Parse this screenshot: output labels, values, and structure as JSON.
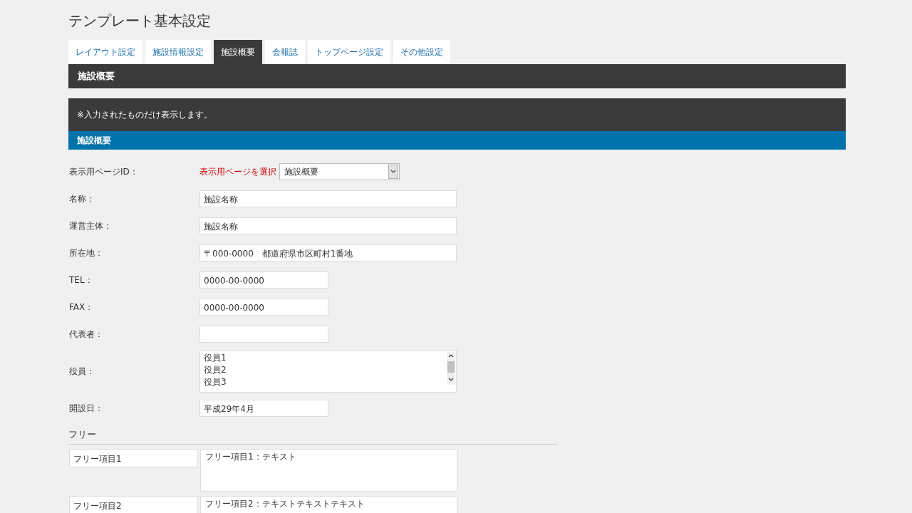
{
  "page_title": "テンプレート基本設定",
  "tabs": [
    {
      "label": "レイアウト設定",
      "selected": false
    },
    {
      "label": "施設情報設定",
      "selected": false
    },
    {
      "label": "施設概要",
      "selected": true
    },
    {
      "label": "会報誌",
      "selected": false
    },
    {
      "label": "トップページ設定",
      "selected": false
    },
    {
      "label": "その他設定",
      "selected": false
    }
  ],
  "section_title": "施設概要",
  "notice": "※入力されたものだけ表示します。",
  "subsection_title": "施設概要",
  "fields": [
    {
      "kind": "select",
      "label": "表示用ページID：",
      "hint": "表示用ページを選択",
      "value": "施設概要"
    },
    {
      "kind": "long_text",
      "label": "名称：",
      "value": "施設名称"
    },
    {
      "kind": "long_text",
      "label": "運営主体：",
      "value": "施設名称"
    },
    {
      "kind": "long_text",
      "label": "所在地：",
      "value": "〒000-0000　都道府県市区町村1番地"
    },
    {
      "kind": "short_text",
      "label": "TEL：",
      "value": "0000-00-0000"
    },
    {
      "kind": "short_text",
      "label": "FAX：",
      "value": "0000-00-0000"
    },
    {
      "kind": "short_text",
      "label": "代表者："
    },
    {
      "kind": "list",
      "label": "役員：",
      "lines": [
        "役員1",
        "役員2",
        "役員3"
      ]
    },
    {
      "kind": "short_text",
      "label": "開設日：",
      "value": "平成29年4月"
    }
  ],
  "free_heading": "フリー",
  "free_items": [
    {
      "name": "フリー項目1",
      "text": "フリー項目1：テキスト"
    },
    {
      "name": "フリー項目2",
      "text": "フリー項目2：テキストテキストテキスト"
    }
  ]
}
